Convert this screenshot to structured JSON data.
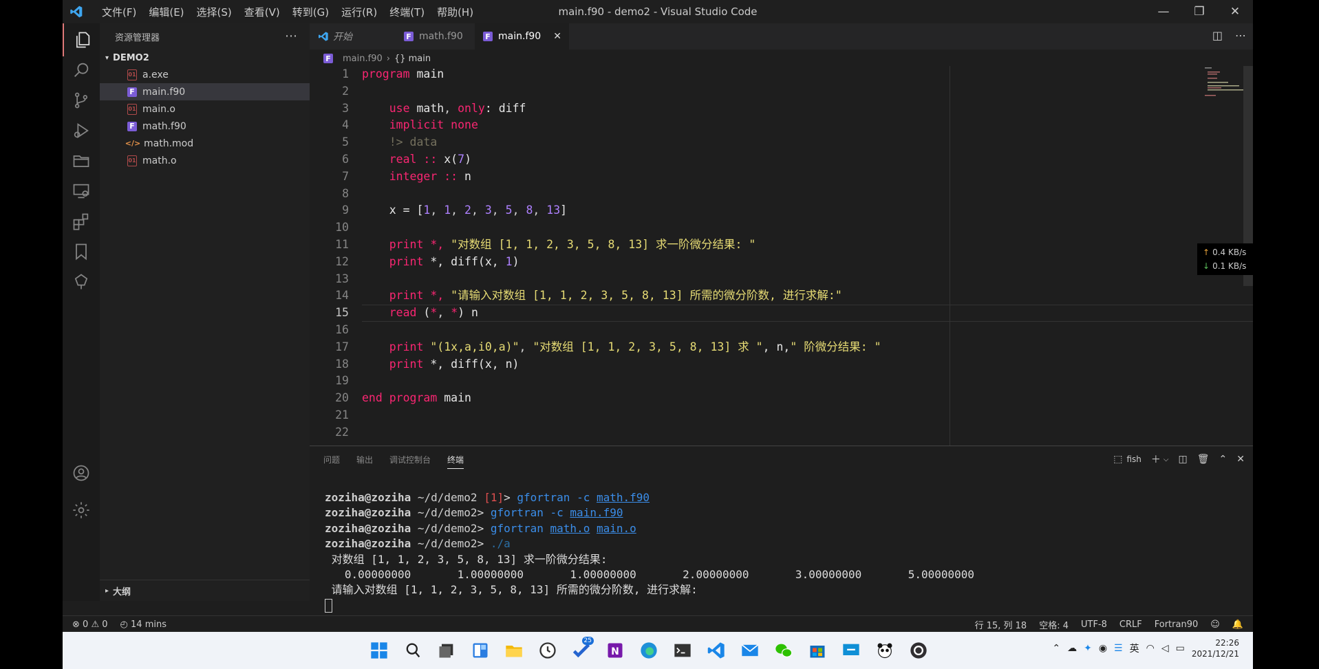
{
  "window": {
    "title": "main.f90 - demo2 - Visual Studio Code",
    "menu": [
      "文件(F)",
      "编辑(E)",
      "选择(S)",
      "查看(V)",
      "转到(G)",
      "运行(R)",
      "终端(T)",
      "帮助(H)"
    ]
  },
  "sidebar": {
    "header": "资源管理器",
    "folder": "DEMO2",
    "files": [
      "a.exe",
      "main.f90",
      "main.o",
      "math.f90",
      "math.mod",
      "math.o"
    ],
    "outline": "大纲"
  },
  "tabs": [
    "开始",
    "math.f90",
    "main.f90"
  ],
  "breadcrumb": {
    "file": "main.f90",
    "symbol": "{} main"
  },
  "code": {
    "l1a": "program",
    "l1b": " main",
    "l3a": "use",
    "l3b": " math",
    "l3c": ", ",
    "l3d": "only",
    "l3e": ": diff",
    "l4a": "implicit",
    "l4b": " none",
    "l5": "!> data",
    "l6a": "real",
    "l6b": " :: ",
    "l6c": "x(",
    "l6d": "7",
    "l6e": ")",
    "l7a": "integer",
    "l7b": " :: ",
    "l7c": "n",
    "l9a": "x = [",
    "l9b": "1",
    "l9c": ", ",
    "l9d": "1",
    "l9e": ", ",
    "l9f": "2",
    "l9g": ", ",
    "l9h": "3",
    "l9i": ", ",
    "l9j": "5",
    "l9k": ", ",
    "l9l": "8",
    "l9m": ", ",
    "l9n": "13",
    "l9o": "]",
    "l11a": "print",
    "l11b": " *, ",
    "l11c": "\"对数组 [1, 1, 2, 3, 5, 8, 13] 求一阶微分结果: \"",
    "l12a": "print",
    "l12b": " *, diff(x, ",
    "l12c": "1",
    "l12d": ")",
    "l14a": "print",
    "l14b": " *, ",
    "l14c": "\"请输入对数组 [1, 1, 2, 3, 5, 8, 13] 所需的微分阶数, 进行求解:\"",
    "l15a": "read",
    "l15b": " (",
    "l15c": "*",
    "l15d": ", ",
    "l15e": "*",
    "l15f": ") n",
    "l17a": "print",
    "l17b": " ",
    "l17c": "\"(1x,a,i0,a)\"",
    "l17d": ", ",
    "l17e": "\"对数组 [1, 1, 2, 3, 5, 8, 13] 求 \"",
    "l17f": ", n,",
    "l17g": "\" 阶微分结果: \"",
    "l18a": "print",
    "l18b": " *, diff(x, n)",
    "l20a": "end",
    "l20b": " ",
    "l20c": "program",
    "l20d": " main"
  },
  "netspeed": {
    "up": "0.4 KB/s",
    "down": "0.1 KB/s"
  },
  "panel": {
    "tabs": [
      "问题",
      "输出",
      "调试控制台",
      "终端"
    ],
    "shell": "fish"
  },
  "terminal": {
    "user": "zoziha@zoziha",
    "path1": " ~/d/demo2 ",
    "err": "[1]",
    "path2": " ~/d/demo2",
    "prompt": "> ",
    "c1a": "gfortran",
    "c1b": " -c ",
    "c1c": "math.f90",
    "c2a": "gfortran",
    "c2b": " -c ",
    "c2c": "main.f90",
    "c3a": "gfortran",
    "c3b": " ",
    "c3c": "math.o",
    "c3d": " ",
    "c3e": "main.o",
    "c4": "./a",
    "out1": " 对数组 [1, 1, 2, 3, 5, 8, 13] 求一阶微分结果:",
    "out2": "   0.00000000       1.00000000       1.00000000       2.00000000       3.00000000       5.00000000",
    "out3": " 请输入对数组 [1, 1, 2, 3, 5, 8, 13] 所需的微分阶数, 进行求解:"
  },
  "status": {
    "errors": "0",
    "warnings": "0",
    "time": "14 mins",
    "position": "行 15, 列 18",
    "spaces": "空格: 4",
    "encoding": "UTF-8",
    "eol": "CRLF",
    "language": "Fortran90"
  },
  "taskbar": {
    "badge": "25",
    "ime": "英",
    "time": "22:26",
    "date": "2021/12/21"
  },
  "colors": {
    "keyword": "#f92672",
    "string": "#e6db74",
    "number": "#ae81ff",
    "comment": "#75715e",
    "accent": "#007acc"
  }
}
